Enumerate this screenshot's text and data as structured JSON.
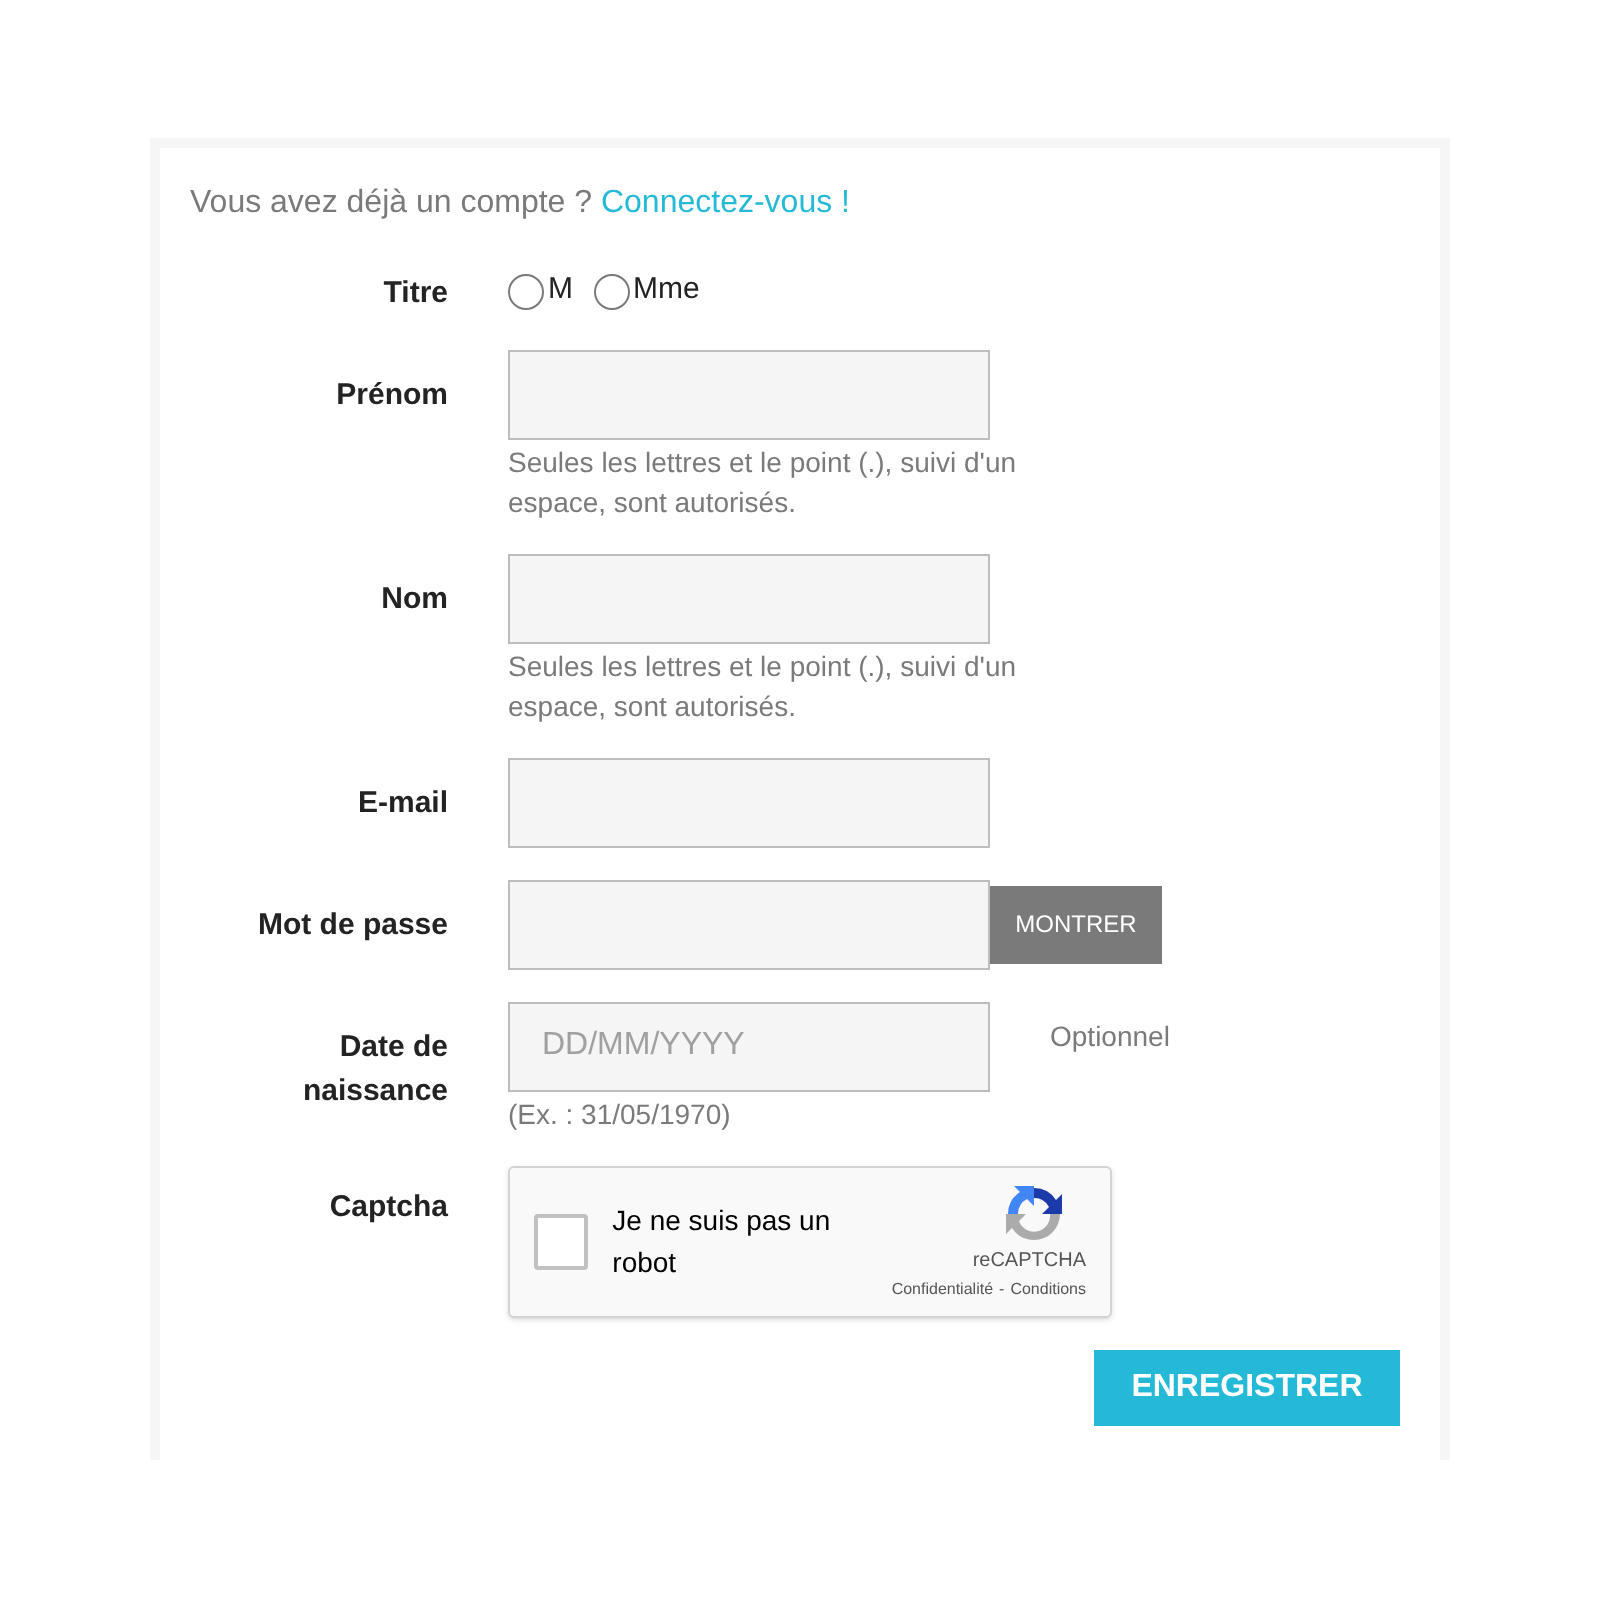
{
  "login_prompt": {
    "text": "Vous avez déjà un compte ?",
    "link": "Connectez-vous !"
  },
  "fields": [
    {
      "kind": "radio",
      "label": "Titre",
      "options": [
        {
          "label": "M",
          "selected": false
        },
        {
          "label": "Mme",
          "selected": false
        }
      ]
    },
    {
      "kind": "text",
      "label": "Prénom",
      "help": "Seules les lettres et le point (.), suivi d'un espace, sont autorisés."
    },
    {
      "kind": "text",
      "label": "Nom",
      "help": "Seules les lettres et le point (.), suivi d'un espace, sont autorisés."
    },
    {
      "kind": "text",
      "label": "E-mail"
    },
    {
      "kind": "password",
      "label": "Mot de passe",
      "button": "MONTRER"
    },
    {
      "kind": "date",
      "label": "Date de naissance",
      "placeholder": "DD/MM/YYYY",
      "note": "Optionnel",
      "help": "(Ex. : 31/05/1970)"
    },
    {
      "kind": "captcha",
      "label": "Captcha",
      "checkbox_label": "Je ne suis pas un robot",
      "checked": false,
      "brand": "reCAPTCHA",
      "links": [
        "Confidentialité",
        "Conditions"
      ],
      "separator": "-"
    }
  ],
  "submit": "ENREGISTRER"
}
